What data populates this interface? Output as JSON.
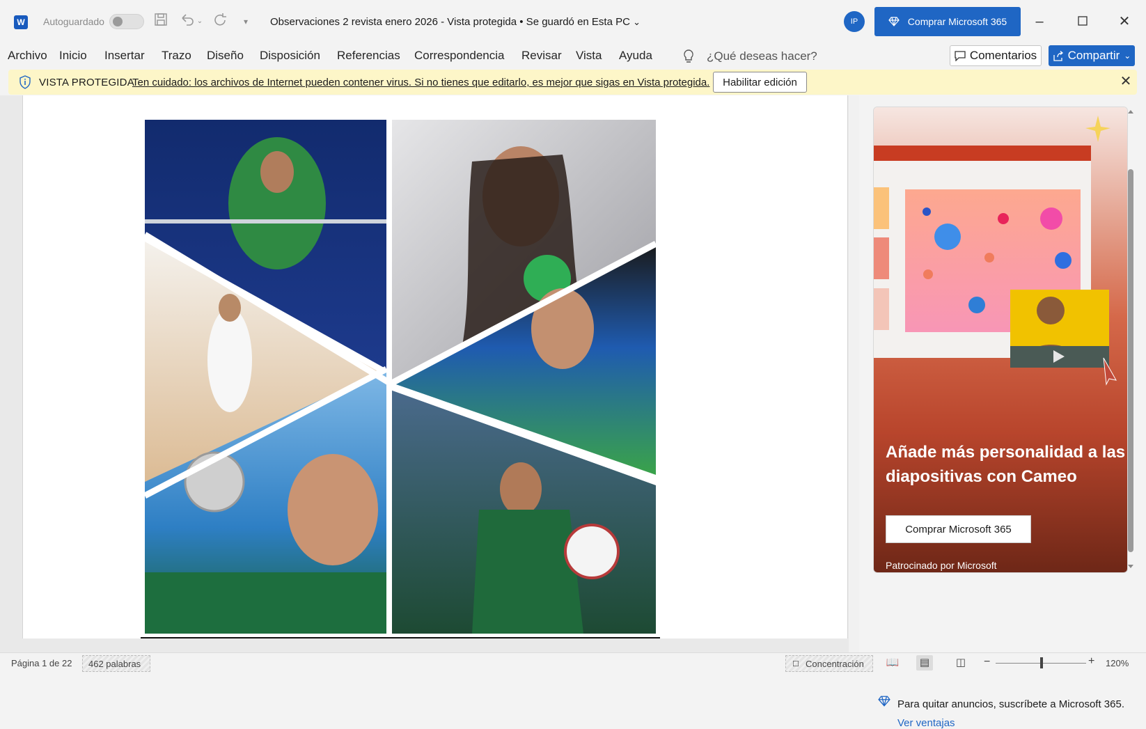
{
  "app": {
    "autosave_label": "Autoguardado",
    "document_title": "Observaciones 2 revista enero 2026  -  Vista protegida  •  Se guardó en Esta PC",
    "avatar_initials": "IP",
    "buy_button": "Comprar Microsoft 365",
    "accent_color": "#1f66c4"
  },
  "menu": {
    "items": [
      "Archivo",
      "Inicio",
      "Insertar",
      "Trazo",
      "Diseño",
      "Disposición",
      "Referencias",
      "Correspondencia",
      "Revisar",
      "Vista",
      "Ayuda"
    ],
    "search_placeholder": "¿Qué deseas hacer?",
    "comments": "Comentarios",
    "share": "Compartir"
  },
  "protected_view": {
    "title": "VISTA PROTEGIDA",
    "message": "Ten cuidado: los archivos de Internet pueden contener virus. Si no tienes que editarlo, es mejor que sigas en Vista protegida.",
    "enable_button": "Habilitar edición",
    "bar_color": "#fdf6c8"
  },
  "ad_pane": {
    "headline": "Añade más personalidad a las diapositivas con Cameo",
    "buy_button": "Comprar Microsoft 365",
    "sponsor": "Patrocinado por Microsoft",
    "remove_ads": "Para quitar anuncios, suscríbete a Microsoft 365.",
    "see_benefits": "Ver ventajas"
  },
  "status": {
    "page": "Página 1 de 22",
    "words": "462 palabras",
    "focus": "Concentración",
    "zoom": "120%"
  }
}
